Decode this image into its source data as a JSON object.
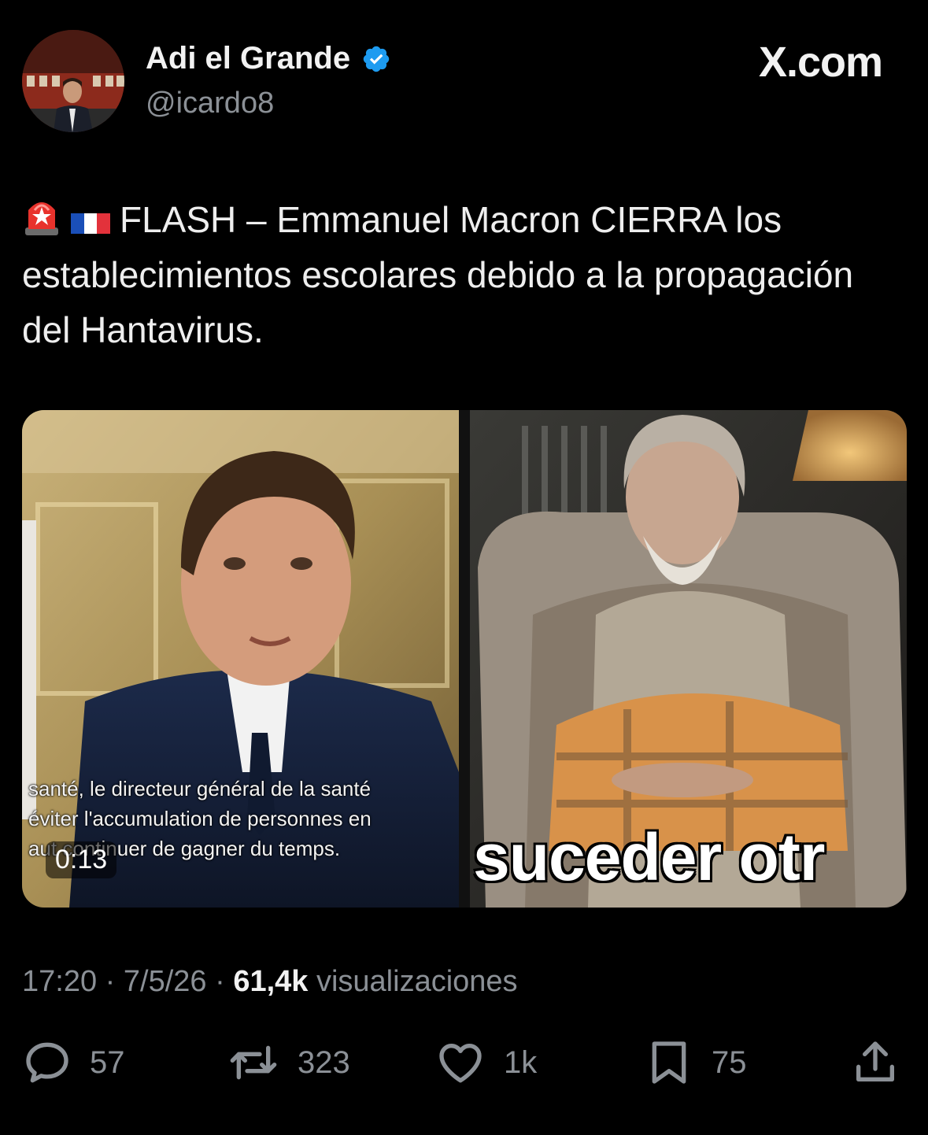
{
  "author": {
    "display_name": "Adi el Grande",
    "handle": "@icardo8",
    "verified": true
  },
  "brand": "X.com",
  "tweet": {
    "emojis": [
      "rotating-light-emoji",
      "france-flag-emoji"
    ],
    "text": "FLASH – Emmanuel Macron CIERRA los establecimientos escolares debido a la propagación del Hantavirus."
  },
  "media": {
    "left": {
      "subtitle_lines": [
        "santé, le directeur général de la santé",
        "éviter l'accumulation de personnes en",
        "aut continuer de gagner du temps."
      ],
      "duration": "0:13"
    },
    "right": {
      "caption": "suceder otr"
    }
  },
  "meta": {
    "time": "17:20",
    "date": "7/5/26",
    "views": "61,4k",
    "views_label": "visualizaciones"
  },
  "actions": {
    "replies": "57",
    "reposts": "323",
    "likes": "1k",
    "bookmarks": "75"
  },
  "colors": {
    "background": "#000000",
    "text": "#e7e9ea",
    "muted": "#8b9096",
    "verified": "#1d9bf0"
  }
}
